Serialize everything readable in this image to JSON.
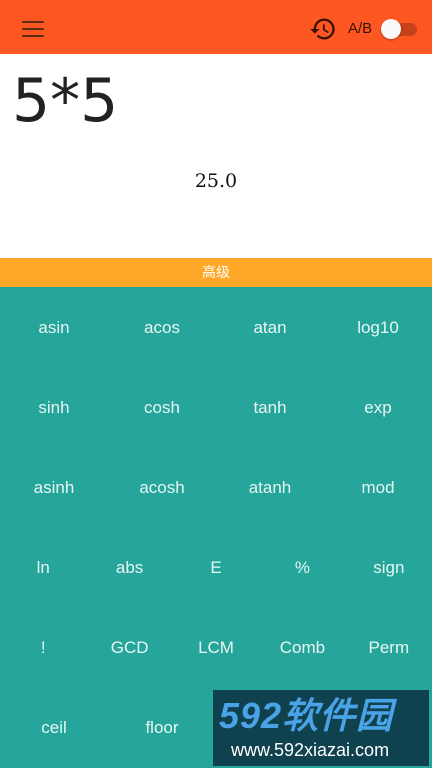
{
  "toolbar": {
    "ab_label": "A/B",
    "toggle_on": false,
    "bg_color": "#ff5722",
    "icons": {
      "menu": "menu-icon",
      "history": "history-icon"
    }
  },
  "display": {
    "expression": "5*5",
    "result": "25.0"
  },
  "tab": {
    "label": "高级",
    "bg_color": "#ffa726"
  },
  "keypad": {
    "bg_color": "#26a69a",
    "rows": [
      [
        "asin",
        "acos",
        "atan",
        "log10"
      ],
      [
        "sinh",
        "cosh",
        "tanh",
        "exp"
      ],
      [
        "asinh",
        "acosh",
        "atanh",
        "mod"
      ],
      [
        "ln",
        "abs",
        "E",
        "%",
        "sign"
      ],
      [
        "!",
        "GCD",
        "LCM",
        "Comb",
        "Perm"
      ],
      [
        "ceil",
        "floor",
        "",
        ""
      ]
    ]
  },
  "watermark": {
    "title": "592软件园",
    "url": "www.592xiazai.com"
  }
}
